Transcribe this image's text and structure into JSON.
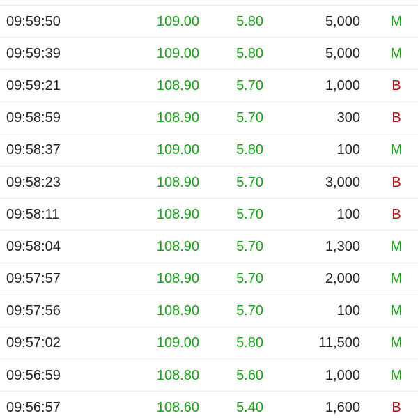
{
  "colors": {
    "up": "#1aa01a",
    "buy": "#1aa01a",
    "sell": "#b01010",
    "text": "#222222",
    "divider": "#ececec"
  },
  "trades": [
    {
      "time": "09:59:50",
      "price": "109.00",
      "change": "5.80",
      "volume": "5,000",
      "side": "M"
    },
    {
      "time": "09:59:39",
      "price": "109.00",
      "change": "5.80",
      "volume": "5,000",
      "side": "M"
    },
    {
      "time": "09:59:21",
      "price": "108.90",
      "change": "5.70",
      "volume": "1,000",
      "side": "B"
    },
    {
      "time": "09:58:59",
      "price": "108.90",
      "change": "5.70",
      "volume": "300",
      "side": "B"
    },
    {
      "time": "09:58:37",
      "price": "109.00",
      "change": "5.80",
      "volume": "100",
      "side": "M"
    },
    {
      "time": "09:58:23",
      "price": "108.90",
      "change": "5.70",
      "volume": "3,000",
      "side": "B"
    },
    {
      "time": "09:58:11",
      "price": "108.90",
      "change": "5.70",
      "volume": "100",
      "side": "B"
    },
    {
      "time": "09:58:04",
      "price": "108.90",
      "change": "5.70",
      "volume": "1,300",
      "side": "M"
    },
    {
      "time": "09:57:57",
      "price": "108.90",
      "change": "5.70",
      "volume": "2,000",
      "side": "M"
    },
    {
      "time": "09:57:56",
      "price": "108.90",
      "change": "5.70",
      "volume": "100",
      "side": "M"
    },
    {
      "time": "09:57:02",
      "price": "109.00",
      "change": "5.80",
      "volume": "11,500",
      "side": "M"
    },
    {
      "time": "09:56:59",
      "price": "108.80",
      "change": "5.60",
      "volume": "1,000",
      "side": "M"
    },
    {
      "time": "09:56:57",
      "price": "108.60",
      "change": "5.40",
      "volume": "1,600",
      "side": "B"
    }
  ]
}
